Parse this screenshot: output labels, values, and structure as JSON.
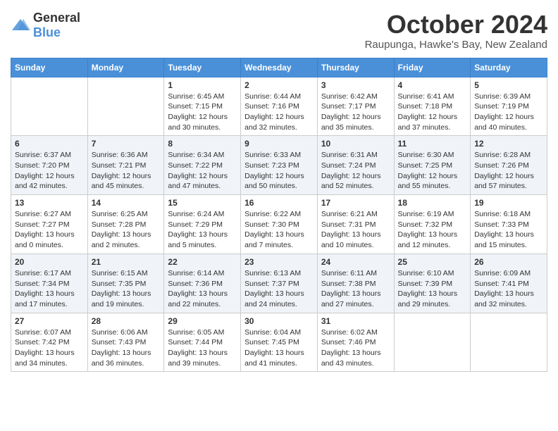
{
  "header": {
    "logo": {
      "general": "General",
      "blue": "Blue"
    },
    "title": "October 2024",
    "location": "Raupunga, Hawke's Bay, New Zealand"
  },
  "weekdays": [
    "Sunday",
    "Monday",
    "Tuesday",
    "Wednesday",
    "Thursday",
    "Friday",
    "Saturday"
  ],
  "weeks": [
    [
      {
        "day": "",
        "info": ""
      },
      {
        "day": "",
        "info": ""
      },
      {
        "day": "1",
        "info": "Sunrise: 6:45 AM\nSunset: 7:15 PM\nDaylight: 12 hours and 30 minutes."
      },
      {
        "day": "2",
        "info": "Sunrise: 6:44 AM\nSunset: 7:16 PM\nDaylight: 12 hours and 32 minutes."
      },
      {
        "day": "3",
        "info": "Sunrise: 6:42 AM\nSunset: 7:17 PM\nDaylight: 12 hours and 35 minutes."
      },
      {
        "day": "4",
        "info": "Sunrise: 6:41 AM\nSunset: 7:18 PM\nDaylight: 12 hours and 37 minutes."
      },
      {
        "day": "5",
        "info": "Sunrise: 6:39 AM\nSunset: 7:19 PM\nDaylight: 12 hours and 40 minutes."
      }
    ],
    [
      {
        "day": "6",
        "info": "Sunrise: 6:37 AM\nSunset: 7:20 PM\nDaylight: 12 hours and 42 minutes."
      },
      {
        "day": "7",
        "info": "Sunrise: 6:36 AM\nSunset: 7:21 PM\nDaylight: 12 hours and 45 minutes."
      },
      {
        "day": "8",
        "info": "Sunrise: 6:34 AM\nSunset: 7:22 PM\nDaylight: 12 hours and 47 minutes."
      },
      {
        "day": "9",
        "info": "Sunrise: 6:33 AM\nSunset: 7:23 PM\nDaylight: 12 hours and 50 minutes."
      },
      {
        "day": "10",
        "info": "Sunrise: 6:31 AM\nSunset: 7:24 PM\nDaylight: 12 hours and 52 minutes."
      },
      {
        "day": "11",
        "info": "Sunrise: 6:30 AM\nSunset: 7:25 PM\nDaylight: 12 hours and 55 minutes."
      },
      {
        "day": "12",
        "info": "Sunrise: 6:28 AM\nSunset: 7:26 PM\nDaylight: 12 hours and 57 minutes."
      }
    ],
    [
      {
        "day": "13",
        "info": "Sunrise: 6:27 AM\nSunset: 7:27 PM\nDaylight: 13 hours and 0 minutes."
      },
      {
        "day": "14",
        "info": "Sunrise: 6:25 AM\nSunset: 7:28 PM\nDaylight: 13 hours and 2 minutes."
      },
      {
        "day": "15",
        "info": "Sunrise: 6:24 AM\nSunset: 7:29 PM\nDaylight: 13 hours and 5 minutes."
      },
      {
        "day": "16",
        "info": "Sunrise: 6:22 AM\nSunset: 7:30 PM\nDaylight: 13 hours and 7 minutes."
      },
      {
        "day": "17",
        "info": "Sunrise: 6:21 AM\nSunset: 7:31 PM\nDaylight: 13 hours and 10 minutes."
      },
      {
        "day": "18",
        "info": "Sunrise: 6:19 AM\nSunset: 7:32 PM\nDaylight: 13 hours and 12 minutes."
      },
      {
        "day": "19",
        "info": "Sunrise: 6:18 AM\nSunset: 7:33 PM\nDaylight: 13 hours and 15 minutes."
      }
    ],
    [
      {
        "day": "20",
        "info": "Sunrise: 6:17 AM\nSunset: 7:34 PM\nDaylight: 13 hours and 17 minutes."
      },
      {
        "day": "21",
        "info": "Sunrise: 6:15 AM\nSunset: 7:35 PM\nDaylight: 13 hours and 19 minutes."
      },
      {
        "day": "22",
        "info": "Sunrise: 6:14 AM\nSunset: 7:36 PM\nDaylight: 13 hours and 22 minutes."
      },
      {
        "day": "23",
        "info": "Sunrise: 6:13 AM\nSunset: 7:37 PM\nDaylight: 13 hours and 24 minutes."
      },
      {
        "day": "24",
        "info": "Sunrise: 6:11 AM\nSunset: 7:38 PM\nDaylight: 13 hours and 27 minutes."
      },
      {
        "day": "25",
        "info": "Sunrise: 6:10 AM\nSunset: 7:39 PM\nDaylight: 13 hours and 29 minutes."
      },
      {
        "day": "26",
        "info": "Sunrise: 6:09 AM\nSunset: 7:41 PM\nDaylight: 13 hours and 32 minutes."
      }
    ],
    [
      {
        "day": "27",
        "info": "Sunrise: 6:07 AM\nSunset: 7:42 PM\nDaylight: 13 hours and 34 minutes."
      },
      {
        "day": "28",
        "info": "Sunrise: 6:06 AM\nSunset: 7:43 PM\nDaylight: 13 hours and 36 minutes."
      },
      {
        "day": "29",
        "info": "Sunrise: 6:05 AM\nSunset: 7:44 PM\nDaylight: 13 hours and 39 minutes."
      },
      {
        "day": "30",
        "info": "Sunrise: 6:04 AM\nSunset: 7:45 PM\nDaylight: 13 hours and 41 minutes."
      },
      {
        "day": "31",
        "info": "Sunrise: 6:02 AM\nSunset: 7:46 PM\nDaylight: 13 hours and 43 minutes."
      },
      {
        "day": "",
        "info": ""
      },
      {
        "day": "",
        "info": ""
      }
    ]
  ]
}
